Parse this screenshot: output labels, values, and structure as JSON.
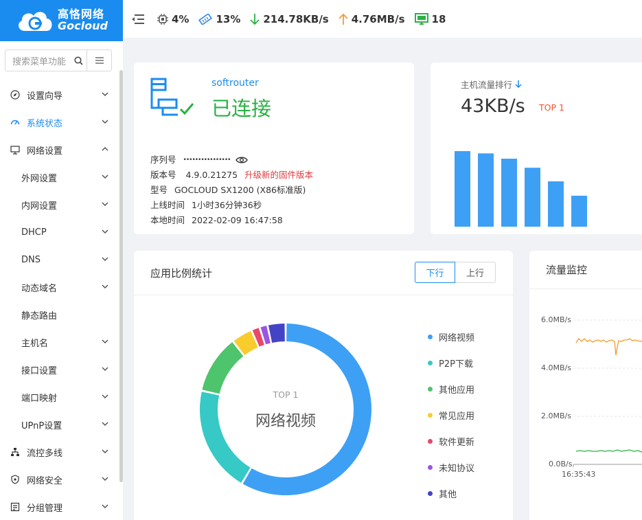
{
  "brand": {
    "name_cn": "高恪网络",
    "name_en": "Gocloud",
    "color": "#1a8cf0"
  },
  "topbar": {
    "cpu": "4%",
    "memory": "13%",
    "download": "214.78KB/s",
    "upload": "4.76MB/s",
    "hosts": "18"
  },
  "sidebar": {
    "search_placeholder": "搜索菜单功能",
    "items": [
      {
        "label": "设置向导",
        "icon": "compass-icon"
      },
      {
        "label": "系统状态",
        "icon": "dashboard-icon",
        "active": true
      },
      {
        "label": "网络设置",
        "icon": "monitor-icon",
        "expanded": true
      },
      {
        "label": "外网设置",
        "sub": true
      },
      {
        "label": "内网设置",
        "sub": true
      },
      {
        "label": "DHCP",
        "sub": true
      },
      {
        "label": "DNS",
        "sub": true
      },
      {
        "label": "动态域名",
        "sub": true
      },
      {
        "label": "静态路由",
        "sub": true
      },
      {
        "label": "主机名",
        "sub": true
      },
      {
        "label": "接口设置",
        "sub": true
      },
      {
        "label": "端口映射",
        "sub": true
      },
      {
        "label": "UPnP设置",
        "sub": true
      },
      {
        "label": "流控多线",
        "icon": "network-icon"
      },
      {
        "label": "网络安全",
        "icon": "shield-icon"
      },
      {
        "label": "分组管理",
        "icon": "group-icon"
      }
    ]
  },
  "device": {
    "name": "softrouter",
    "status": "已连接",
    "serial_label": "序列号",
    "serial_value": "••••••••••••••••",
    "version_label": "版本号",
    "version_value": "4.9.0.21275",
    "upgrade_link": "升级新的固件版本",
    "model_label": "型号",
    "model_value": "GOCLOUD SX1200 (X86标准版)",
    "uptime_label": "上线时间",
    "uptime_value": "1小时36分钟36秒",
    "localtime_label": "本地时间",
    "localtime_value": "2022-02-09 16:47:58"
  },
  "host_rank": {
    "title": "主机流量排行",
    "value": "43KB/s",
    "top": "TOP 1",
    "bars": [
      1.0,
      0.97,
      0.9,
      0.78,
      0.6,
      0.41
    ]
  },
  "app_ratio": {
    "title": "应用比例统计",
    "tabs": [
      "下行",
      "上行"
    ],
    "active_tab": "下行",
    "center_top": "TOP 1",
    "center_label": "网络视频",
    "legend": [
      {
        "label": "网络视频",
        "color": "#3ea0f5"
      },
      {
        "label": "P2P下载",
        "color": "#36c9c6"
      },
      {
        "label": "其他应用",
        "color": "#4ec46c"
      },
      {
        "label": "常见应用",
        "color": "#f9cc2e"
      },
      {
        "label": "软件更新",
        "color": "#e9476b"
      },
      {
        "label": "未知协议",
        "color": "#9a55e2"
      },
      {
        "label": "其他",
        "color": "#4543c5"
      }
    ],
    "shares": [
      58.5,
      20.0,
      11.0,
      4.0,
      1.6,
      1.5,
      3.4
    ]
  },
  "traffic": {
    "title": "流量监控",
    "y_labels": [
      "6.0MB/s",
      "4.0MB/s",
      "2.0MB/s",
      "0.0B/s"
    ],
    "x_start": "16:35:43"
  }
}
